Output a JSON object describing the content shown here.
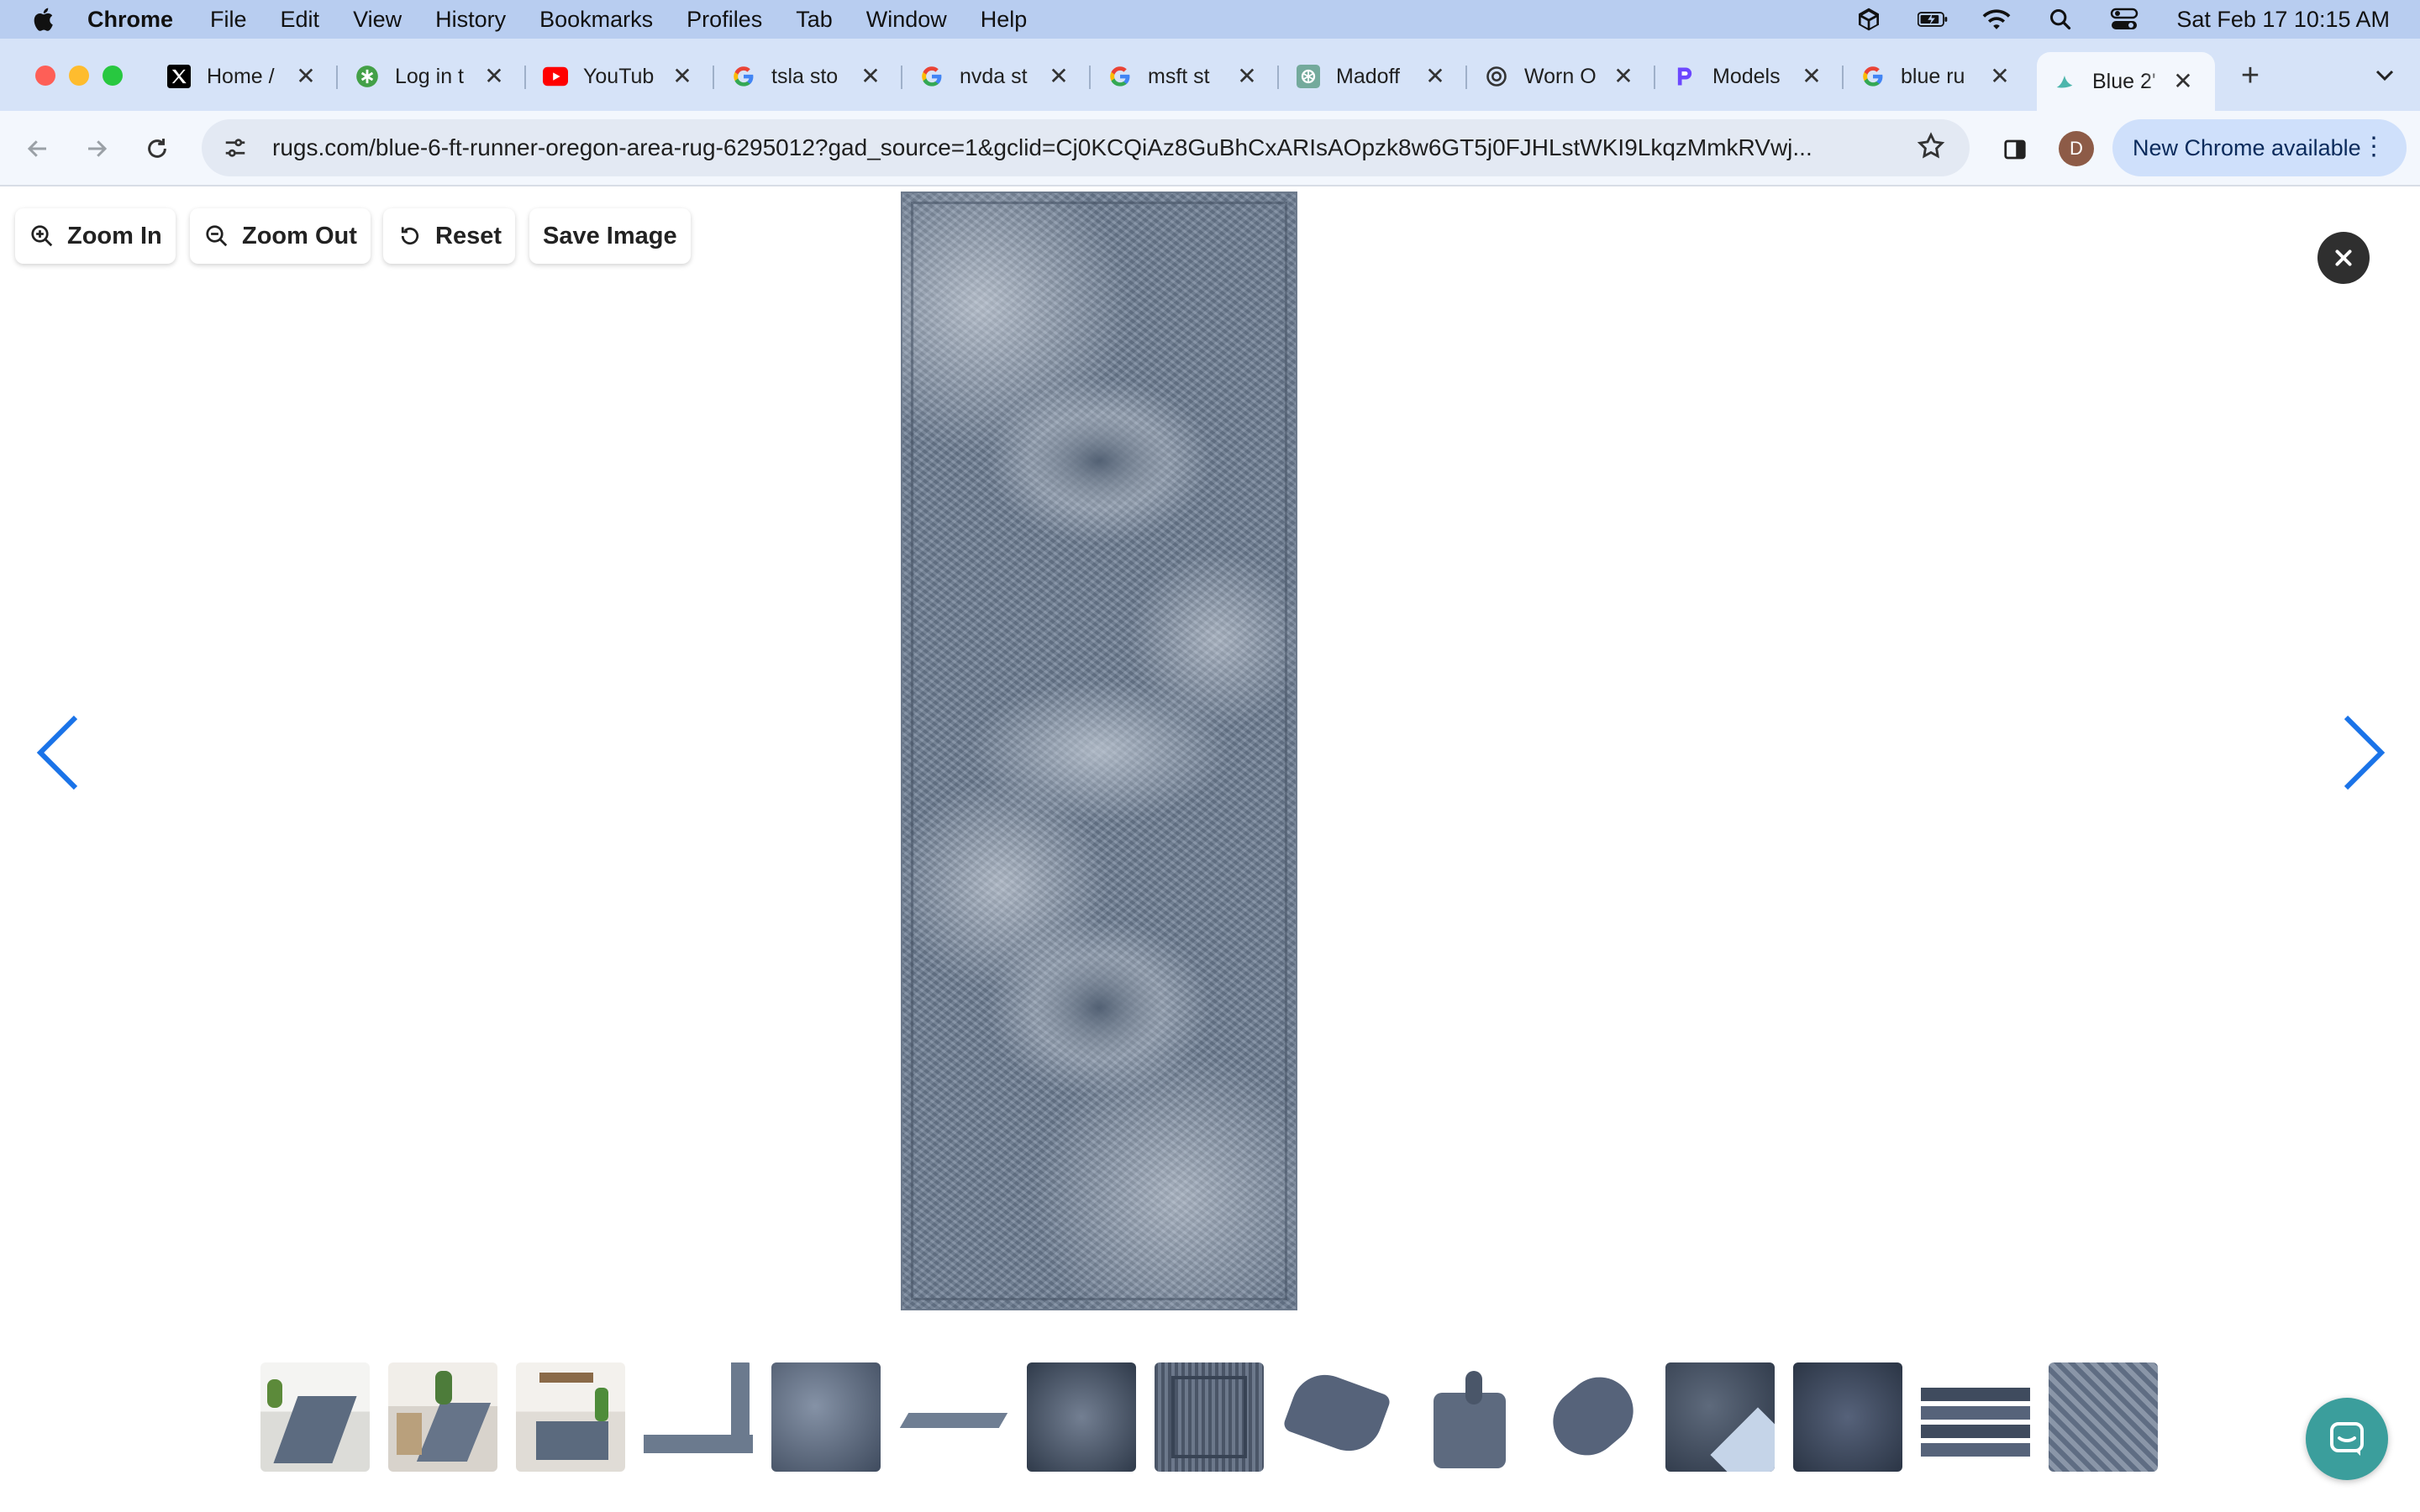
{
  "menubar": {
    "app_name": "Chrome",
    "items": [
      "File",
      "Edit",
      "View",
      "History",
      "Bookmarks",
      "Profiles",
      "Tab",
      "Window",
      "Help"
    ],
    "clock": "Sat Feb 17  10:15 AM",
    "status_icons": [
      "vpn-icon",
      "battery-icon",
      "wifi-icon",
      "spotlight-search-icon",
      "control-center-icon"
    ]
  },
  "tabs": [
    {
      "title": "Home /",
      "icon": "x-logo-icon"
    },
    {
      "title": "Log in t",
      "icon": "linktree-icon"
    },
    {
      "title": "YouTub",
      "icon": "youtube-icon"
    },
    {
      "title": "tsla sto",
      "icon": "google-icon"
    },
    {
      "title": "nvda st",
      "icon": "google-icon"
    },
    {
      "title": "msft st",
      "icon": "google-icon"
    },
    {
      "title": "Madoff",
      "icon": "chatgpt-icon"
    },
    {
      "title": "Worn O",
      "icon": "openai-icon"
    },
    {
      "title": "Models",
      "icon": "perplexity-icon"
    },
    {
      "title": "blue ru",
      "icon": "google-icon"
    },
    {
      "title": "Blue 2'",
      "icon": "rugs-icon",
      "active": true
    }
  ],
  "toolbar": {
    "url": "rugs.com/blue-6-ft-runner-oregon-area-rug-6295012?gad_source=1&gclid=Cj0KCQiAz8GuBhCxARIsAOpzk8w6GT5j0FJHLstWKI9LkqzMmkRVwj...",
    "profile_initial": "D",
    "update_label": "New Chrome available"
  },
  "viewer": {
    "zoom_in": "Zoom In",
    "zoom_out": "Zoom Out",
    "reset": "Reset",
    "save_image": "Save Image",
    "thumbnail_count": 15
  },
  "colors": {
    "menubar_bg": "#b8cdf0",
    "tabstrip_bg": "#d6e3f8",
    "accent_blue": "#1a73e8",
    "chat_teal": "#3b9e9c"
  }
}
